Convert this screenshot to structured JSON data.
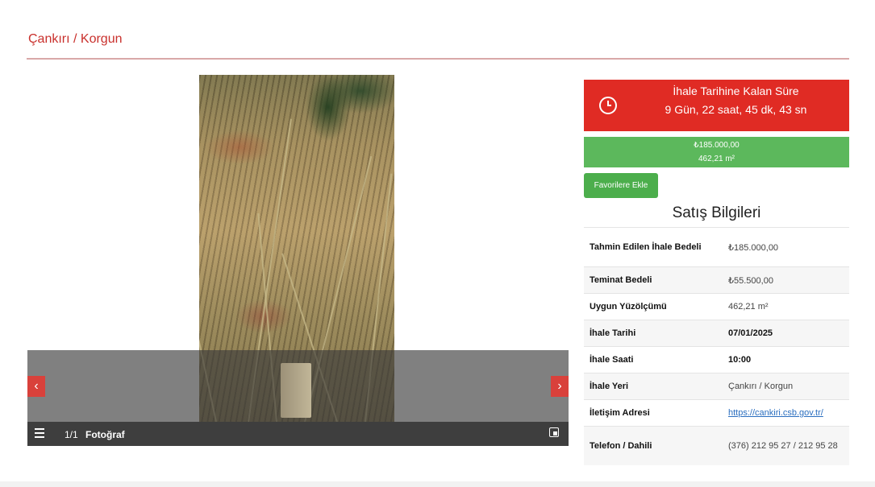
{
  "header": {
    "title": "Çankırı / Korgun"
  },
  "gallery": {
    "counter": "1/1",
    "caption": "Fotoğraf",
    "prev_label": "‹",
    "next_label": "›"
  },
  "timer": {
    "label": "İhale Tarihine Kalan Süre",
    "value": "9 Gün, 22 saat, 45 dk, 43 sn"
  },
  "price_box": {
    "price": "₺185.000,00",
    "area": "462,21 m²"
  },
  "favorite_button": "Favorilere Ekle",
  "section_title": "Satış Bilgileri",
  "info_rows": [
    {
      "key": "Tahmin Edilen İhale Bedeli",
      "value": "₺185.000,00"
    },
    {
      "key": "Teminat Bedeli",
      "value": "₺55.500,00"
    },
    {
      "key": "Uygun Yüzölçümü",
      "value": "462,21 m²"
    },
    {
      "key": "İhale Tarihi",
      "value": "07/01/2025"
    },
    {
      "key": "İhale Saati",
      "value": "10:00"
    },
    {
      "key": "İhale Yeri",
      "value": "Çankırı / Korgun"
    },
    {
      "key": "İletişim Adresi",
      "value": "https://cankiri.csb.gov.tr/"
    },
    {
      "key": "Telefon / Dahili",
      "value": "(376) 212 95 27 / 212 95 28"
    }
  ],
  "colors": {
    "title_red": "#c9302c",
    "timer_red": "#e02b24",
    "price_green": "#5cb85c",
    "button_green": "#4cae4c"
  },
  "icons": [
    "clock-icon",
    "menu-icon",
    "fullscreen-icon",
    "chevron-left-icon",
    "chevron-right-icon"
  ]
}
